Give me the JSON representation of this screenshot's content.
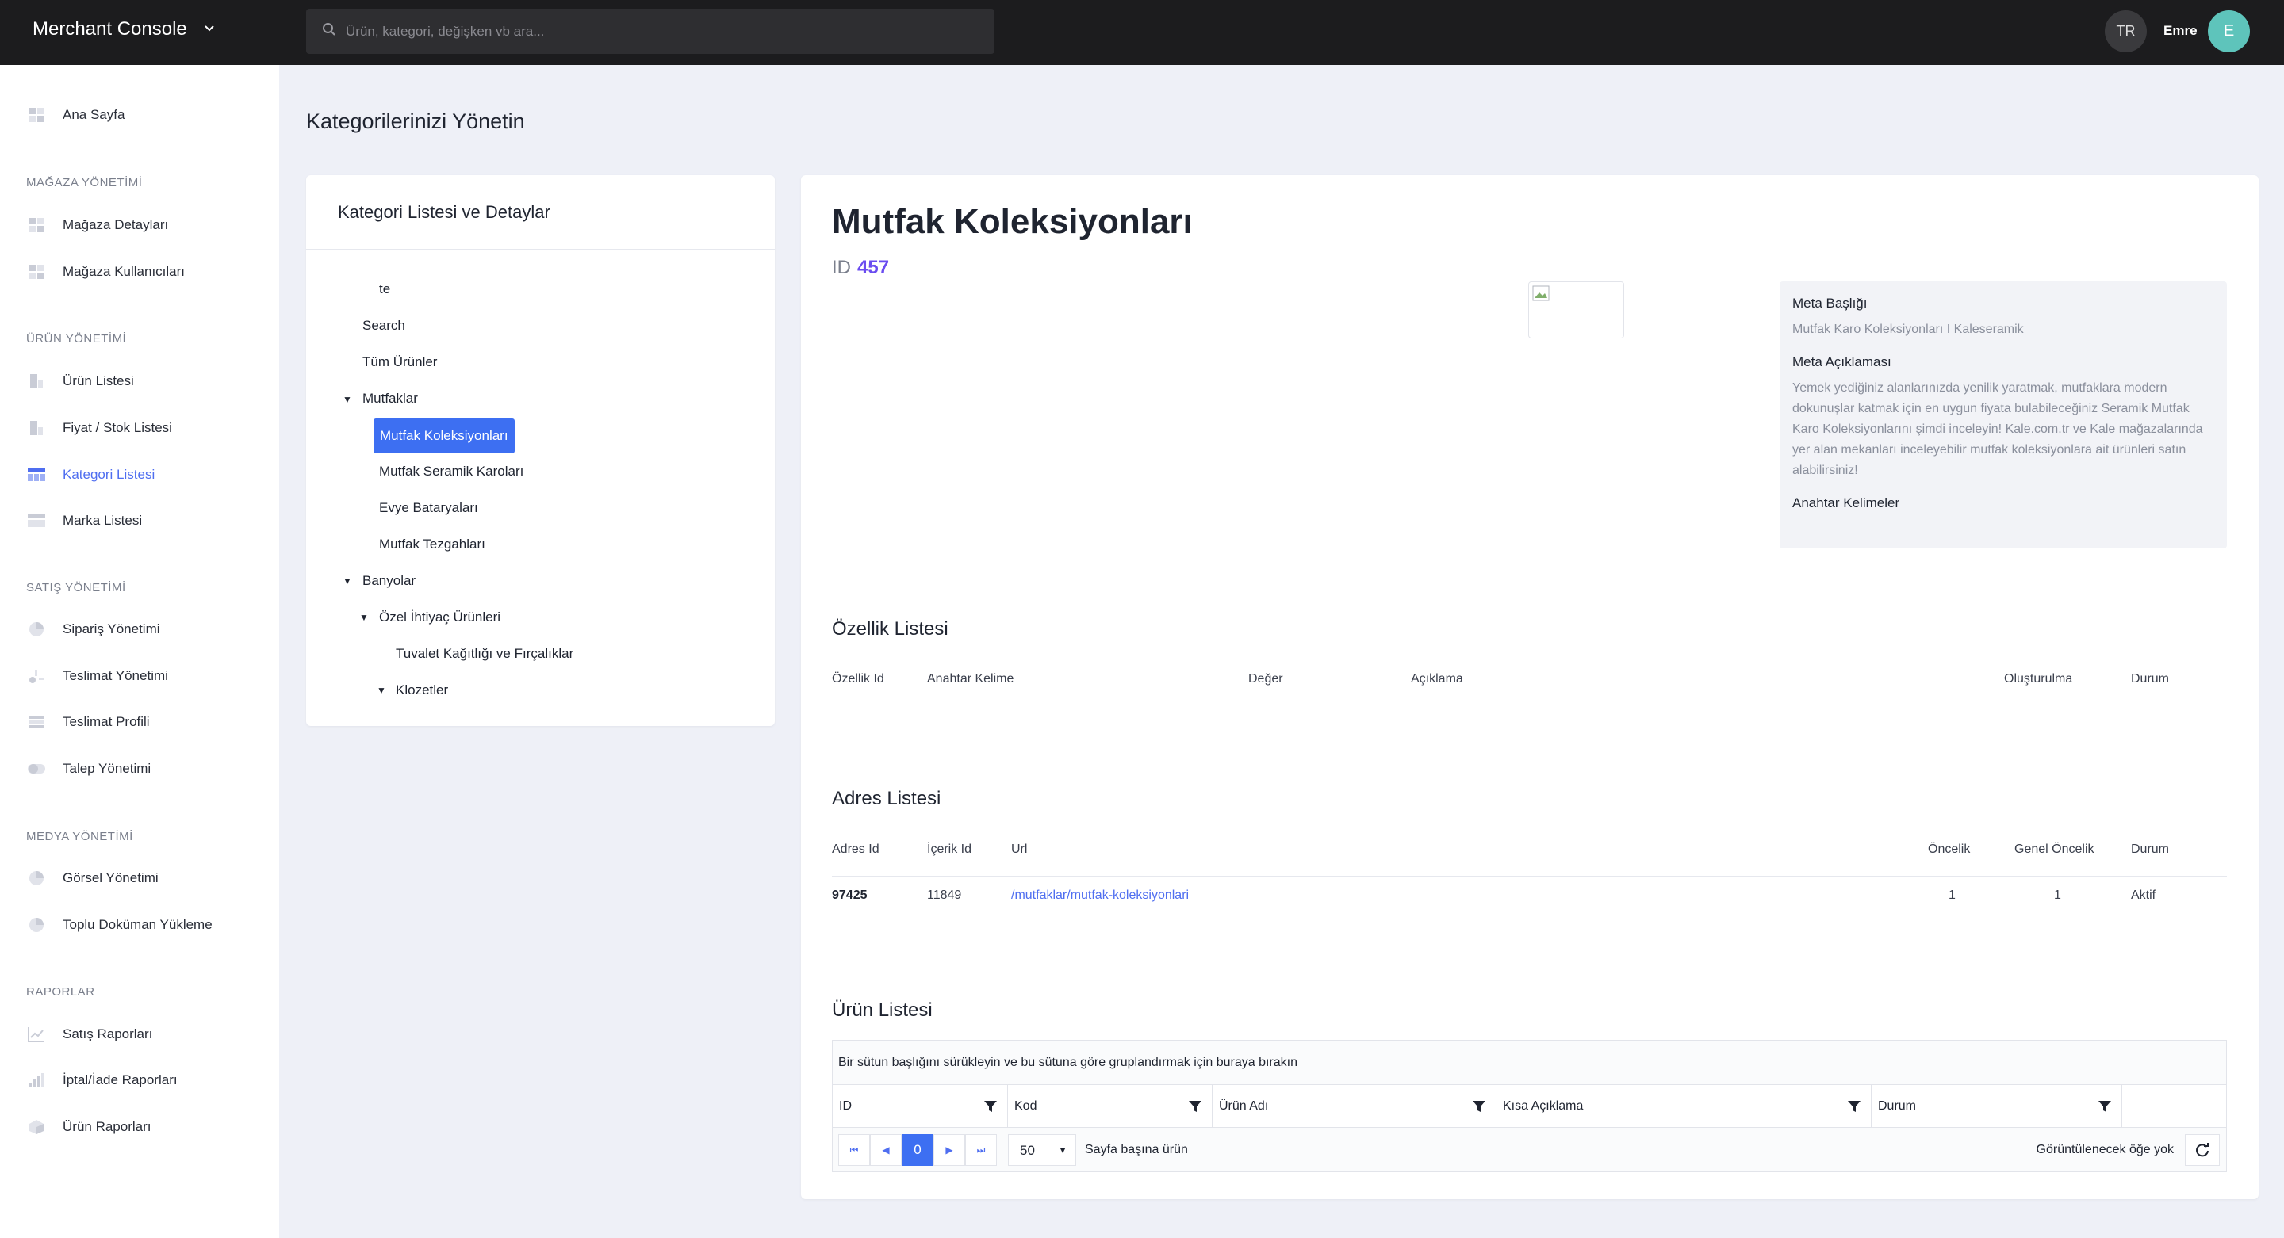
{
  "topbar": {
    "brand": "Merchant Console",
    "search_placeholder": "Ürün, kategori, değişken vb ara...",
    "lang": "TR",
    "user_name": "Emre",
    "avatar_initial": "E",
    "avatar_color": "#5ec4bb"
  },
  "sidebar": {
    "home": "Ana Sayfa",
    "sections": [
      {
        "title": "MAĞAZA YÖNETİMİ",
        "items": [
          "Mağaza Detayları",
          "Mağaza Kullanıcıları"
        ]
      },
      {
        "title": "ÜRÜN YÖNETİMİ",
        "items": [
          "Ürün Listesi",
          "Fiyat / Stok Listesi",
          "Kategori Listesi",
          "Marka Listesi"
        ]
      },
      {
        "title": "SATIŞ YÖNETİMİ",
        "items": [
          "Sipariş Yönetimi",
          "Teslimat Yönetimi",
          "Teslimat Profili",
          "Talep Yönetimi"
        ]
      },
      {
        "title": "MEDYA YÖNETİMİ",
        "items": [
          "Görsel Yönetimi",
          "Toplu Doküman Yükleme"
        ]
      },
      {
        "title": "RAPORLAR",
        "items": [
          "Satış Raporları",
          "İptal/İade Raporları",
          "Ürün Raporları"
        ]
      }
    ],
    "active_item": "Kategori Listesi",
    "accent": "#4f6ef0"
  },
  "page_title": "Kategorilerinizi Yönetin",
  "tree": {
    "header": "Kategori Listesi ve Detaylar",
    "nodes": [
      "te",
      "Search",
      "Tüm Ürünler",
      "Mutfaklar",
      "Mutfak Koleksiyonları",
      "Mutfak Seramik Karoları",
      "Evye Bataryaları",
      "Mutfak Tezgahları",
      "Banyolar",
      "Özel İhtiyaç Ürünleri",
      "Tuvalet Kağıtlığı ve Fırçalıklar",
      "Klozetler"
    ],
    "selected": "Mutfak Koleksiyonları"
  },
  "detail": {
    "title": "Mutfak Koleksiyonları",
    "id_label": "ID",
    "id_value": "457",
    "meta_title_label": "Meta Başlığı",
    "meta_title": "Mutfak Karo Koleksiyonları I Kaleseramik",
    "meta_desc_label": "Meta Açıklaması",
    "meta_desc": "Yemek yediğiniz alanlarınızda yenilik yaratmak, mutfaklara modern dokunuşlar katmak için en uygun fiyata bulabileceğiniz Seramik Mutfak Karo Koleksiyonlarını şimdi inceleyin! Kale.com.tr ve Kale mağazalarında yer alan mekanları inceleyebilir mutfak koleksiyonlara ait ürünleri satın alabilirsiniz!",
    "keywords_label": "Anahtar Kelimeler"
  },
  "features": {
    "title": "Özellik Listesi",
    "columns": [
      "Özellik Id",
      "Anahtar Kelime",
      "Değer",
      "Açıklama",
      "Oluşturulma",
      "Durum"
    ]
  },
  "addresses": {
    "title": "Adres Listesi",
    "columns": [
      "Adres Id",
      "İçerik Id",
      "Url",
      "Öncelik",
      "Genel Öncelik",
      "Durum"
    ],
    "rows": [
      {
        "id": "97425",
        "content_id": "11849",
        "url": "/mutfaklar/mutfak-koleksiyonlari",
        "priority": "1",
        "global_priority": "1",
        "status": "Aktif"
      }
    ]
  },
  "products": {
    "title": "Ürün Listesi",
    "group_hint": "Bir sütun başlığını sürükleyin ve bu sütuna göre gruplandırmak için buraya bırakın",
    "columns": [
      "ID",
      "Kod",
      "Ürün Adı",
      "Kısa Açıklama",
      "Durum"
    ],
    "page": "0",
    "page_size": "50",
    "page_size_label": "Sayfa başına ürün",
    "empty_text": "Görüntülenecek öğe yok"
  }
}
